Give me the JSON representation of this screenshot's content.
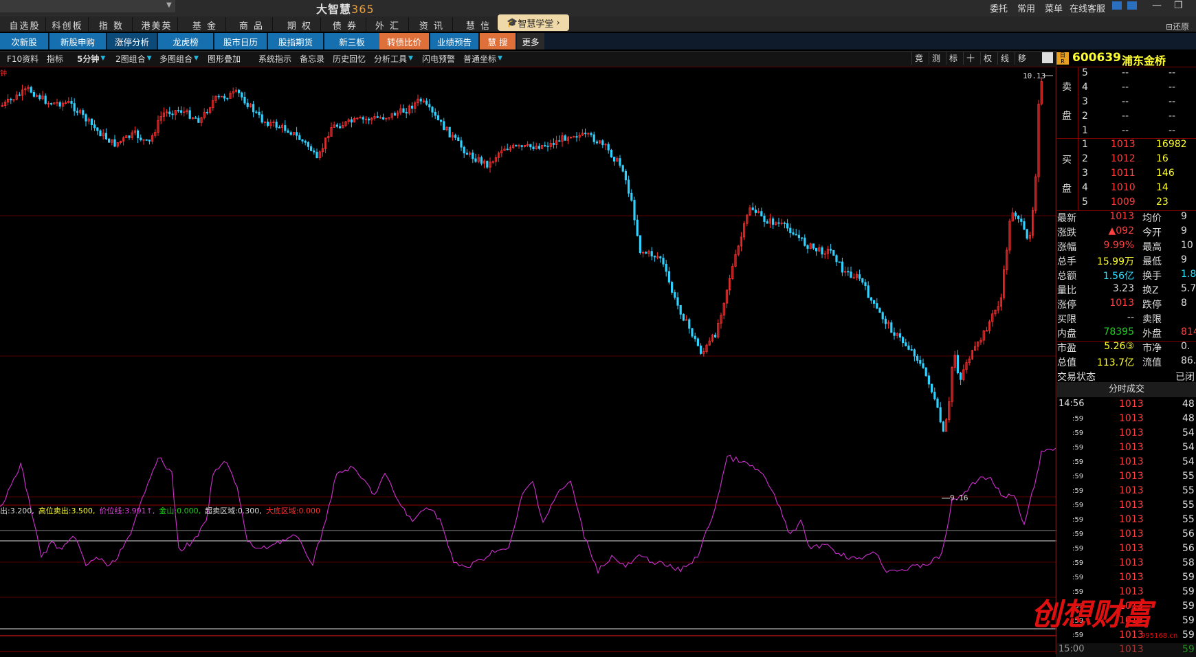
{
  "app": {
    "title": "大智慧",
    "title_num": "365"
  },
  "top_nav": [
    "自选股",
    "科创板",
    "指 数",
    "港美英",
    "基 金",
    "商 品",
    "期 权",
    "债 券",
    "外 汇",
    "资 讯",
    "慧 信"
  ],
  "top_promo": "智慧学堂",
  "top_right": {
    "menu1": "委托",
    "menu2": "常用",
    "menu3": "菜单",
    "menu4": "在线客服",
    "restore": "还原"
  },
  "tabs": [
    "次新股",
    "新股申购",
    "涨停分析",
    "龙虎榜",
    "股市日历",
    "股指期货",
    "新三板",
    "转债比价",
    "业绩预告",
    "慧 搜",
    "更多"
  ],
  "toolbar": [
    "F10资料",
    "指标",
    "5分钟",
    "2图组合",
    "多图组合",
    "图形叠加",
    "系统指示",
    "备忘录",
    "历史回忆",
    "分析工具",
    "闪电预警",
    "普通坐标"
  ],
  "toolbar_right": [
    "竞",
    "测",
    "标",
    "十",
    "权",
    "线",
    "移"
  ],
  "chart": {
    "high_label": "10.13",
    "low_label": "9.16"
  },
  "indicator": [
    {
      "k": "出:",
      "v": "3.200,",
      "color": "#ddd"
    },
    {
      "k": "高位卖出:",
      "v": "3.500,",
      "color": "#ffff30"
    },
    {
      "k": "价位线:",
      "v": "3.991↑,",
      "color": "#e040e0"
    },
    {
      "k": "金山:",
      "v": "0.000,",
      "color": "#20d020"
    },
    {
      "k": "超卖区域:",
      "v": "0.300,",
      "color": "#ddd"
    },
    {
      "k": "大底区域:",
      "v": "0.000",
      "color": "#ff3030"
    }
  ],
  "stock": {
    "code": "600639",
    "name": "浦东金桥"
  },
  "orderbook": {
    "sell_label1": "卖",
    "sell_label2": "盘",
    "buy_label1": "买",
    "buy_label2": "盘",
    "sells": [
      {
        "n": "5",
        "p": "--",
        "v": "--"
      },
      {
        "n": "4",
        "p": "--",
        "v": "--"
      },
      {
        "n": "3",
        "p": "--",
        "v": "--"
      },
      {
        "n": "2",
        "p": "--",
        "v": "--"
      },
      {
        "n": "1",
        "p": "--",
        "v": "--"
      }
    ],
    "buys": [
      {
        "n": "1",
        "p": "1013",
        "v": "16982"
      },
      {
        "n": "2",
        "p": "1012",
        "v": "16"
      },
      {
        "n": "3",
        "p": "1011",
        "v": "146"
      },
      {
        "n": "4",
        "p": "1010",
        "v": "14"
      },
      {
        "n": "5",
        "p": "1009",
        "v": "23"
      }
    ]
  },
  "quote": [
    {
      "l": "最新",
      "v": "1013",
      "vc": "red",
      "l2": "均价",
      "v2": "9"
    },
    {
      "l": "涨跌",
      "v": "▲092",
      "vc": "red",
      "l2": "今开",
      "v2": "9"
    },
    {
      "l": "涨幅",
      "v": "9.99%",
      "vc": "red",
      "l2": "最高",
      "v2": "10"
    },
    {
      "l": "总手",
      "v": "15.99万",
      "vc": "yel",
      "l2": "最低",
      "v2": "9"
    },
    {
      "l": "总额",
      "v": "1.56亿",
      "vc": "cyan",
      "l2": "换手",
      "v2": "1.8"
    },
    {
      "l": "量比",
      "v": "3.23",
      "vc": "wh",
      "l2": "换Z",
      "v2": "5.7"
    },
    {
      "l": "涨停",
      "v": "1013",
      "vc": "red",
      "l2": "跌停",
      "v2": "8"
    },
    {
      "l": "买限",
      "v": "--",
      "vc": "wh",
      "l2": "卖限",
      "v2": ""
    },
    {
      "l": "内盘",
      "v": "78395",
      "vc": "grn",
      "l2": "外盘",
      "v2": "814"
    },
    {
      "l": "市盈",
      "v": "5.26③",
      "vc": "yel",
      "l2": "市净",
      "v2": "0."
    },
    {
      "l": "总值",
      "v": "113.7亿",
      "vc": "yel",
      "l2": "流值",
      "v2": "86.1"
    },
    {
      "l": "交易状态",
      "v": "",
      "vc": "wh",
      "l2": "",
      "v2": "已闭"
    }
  ],
  "ticks_header": "分时成交",
  "ticks": [
    {
      "t": "14:56",
      "p": "1013",
      "v": "48"
    },
    {
      "t": ":59",
      "p": "1013",
      "v": "48"
    },
    {
      "t": ":59",
      "p": "1013",
      "v": "54"
    },
    {
      "t": ":59",
      "p": "1013",
      "v": "54"
    },
    {
      "t": ":59",
      "p": "1013",
      "v": "54"
    },
    {
      "t": ":59",
      "p": "1013",
      "v": "55"
    },
    {
      "t": ":59",
      "p": "1013",
      "v": "55"
    },
    {
      "t": ":59",
      "p": "1013",
      "v": "55"
    },
    {
      "t": ":59",
      "p": "1013",
      "v": "55"
    },
    {
      "t": ":59",
      "p": "1013",
      "v": "56"
    },
    {
      "t": ":59",
      "p": "1013",
      "v": "56"
    },
    {
      "t": ":59",
      "p": "1013",
      "v": "58"
    },
    {
      "t": ":59",
      "p": "1013",
      "v": "59"
    },
    {
      "t": ":59",
      "p": "1013",
      "v": "59"
    },
    {
      "t": ":59",
      "p": "1013",
      "v": "59"
    },
    {
      "t": ":59",
      "p": "1013",
      "v": "59"
    },
    {
      "t": ":59",
      "p": "1013",
      "v": "59"
    },
    {
      "t": "15:00",
      "p": "1013",
      "v": "59"
    }
  ],
  "watermark": "创想财富",
  "watermark_url": "995168.cn",
  "colors": {
    "up": "#ff3030",
    "down": "#30d0ff",
    "osc": "#d030d0",
    "accent": "#1670b0"
  }
}
